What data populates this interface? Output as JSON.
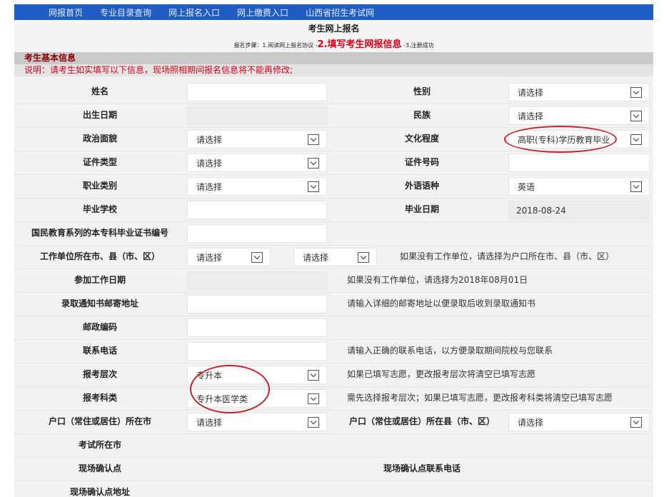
{
  "nav": [
    "网报首页",
    "专业目录查询",
    "网上报名入口",
    "网上缴费入口",
    "山西省招生考试网"
  ],
  "page_title": "考生网上报名",
  "steps": {
    "prefix": "报名步骤：1.阅读网上报名协议 -",
    "current": "2.填写考生网报信息",
    "suffix": " -3.注册成功"
  },
  "section_title": "考生基本信息",
  "notice": "说明：请考生如实填写以下信息，现场照相期间报名信息将不能再修改;",
  "fields": {
    "name": "姓名",
    "gender": "性别",
    "gender_value": "请选择",
    "birth": "出生日期",
    "ethnic": "民族",
    "ethnic_value": "请选择",
    "political": "政治面貌",
    "political_value": "请选择",
    "education": "文化程度",
    "education_value": "高职(专科)学历教育毕业",
    "idtype": "证件类型",
    "idtype_value": "请选择",
    "idnum": "证件号码",
    "job": "职业类别",
    "job_value": "请选择",
    "lang": "外语语种",
    "lang_value": "英语",
    "school": "毕业学校",
    "graddate": "毕业日期",
    "graddate_value": "2018-08-24",
    "certno": "国民教育系列的本专科毕业证书编号",
    "workplace": "工作单位所在市、县（市、区）",
    "workplace_city": "请选择",
    "workplace_county": "请选择",
    "workplace_hint": "如果没有工作单位，请选择为户口所在市、县（市、区）",
    "workdate": "参加工作日期",
    "workdate_hint": "如果没有工作单位，请选择为2018年08月01日",
    "address": "录取通知书邮寄地址",
    "address_hint": "请输入详细的邮寄地址以便录取后收到录取通知书",
    "postcode": "邮政编码",
    "phone": "联系电话",
    "phone_hint": "请输入正确的联系电话，以方便录取期间院校与您联系",
    "level": "报考层次",
    "level_value": "专升本",
    "level_hint": "如果已填写志愿，更改报考层次将清空已填写志愿",
    "subject": "报考科类",
    "subject_value": "专升本医学类",
    "subject_hint": "需先选择报考层次；如果已填写志愿，更改报考科类将清空已填写志愿",
    "hukou_city": "户口（常住或居住）所在市",
    "hukou_city_value": "请选择",
    "hukou_county": "户口（常住或居住）所在县（市、区）",
    "hukou_county_value": "请选择",
    "exam_city": "考试所在市",
    "site": "现场确认点",
    "site_phone": "现场确认点联系电话",
    "site_addr": "现场确认点地址"
  },
  "colors": {
    "nav": "#1f5cc4",
    "highlight": "#d9001b",
    "annotation": "#c0262d"
  }
}
